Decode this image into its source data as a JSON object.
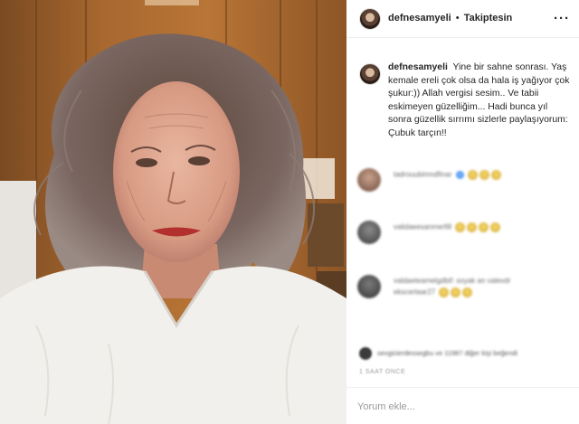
{
  "post": {
    "photo_icon": "portrait-photo",
    "header": {
      "username": "defnesamyeli",
      "separator": "•",
      "follow_status": "Takiptesin",
      "more_icon": "more-horizontal-icon"
    },
    "caption": {
      "username": "defnesamyeli",
      "text": "Yine bir sahne sonrası. Yaş kemale ereli çok olsa da hala iş yağıyor çok şukur:)) Allah vergisi sesim.. Ve tabii eskimeyen güzelliğim... Hadi bunca yıl sonra güzellik sırrımı sizlerle paylaşıyorum: Çubuk tarçın!!"
    },
    "comments": [
      {
        "text": "tadrouubimndfinar",
        "meta": ""
      },
      {
        "text": "validaeesanmerfill",
        "meta": ""
      },
      {
        "text": "valdaeteamelgdbif: soyak an valevdr",
        "meta": "ekscertaar27"
      }
    ],
    "likes_line": "sevgicierdessegbu ve 11987 diğer kişi beğendi",
    "time_ago": "1 SAAT ÖNCE",
    "add_comment_placeholder": "Yorum ekle..."
  },
  "colors": {
    "text": "#262626",
    "muted": "#9a9a9a",
    "border": "#efefef",
    "emoji": "#e8c45a"
  }
}
